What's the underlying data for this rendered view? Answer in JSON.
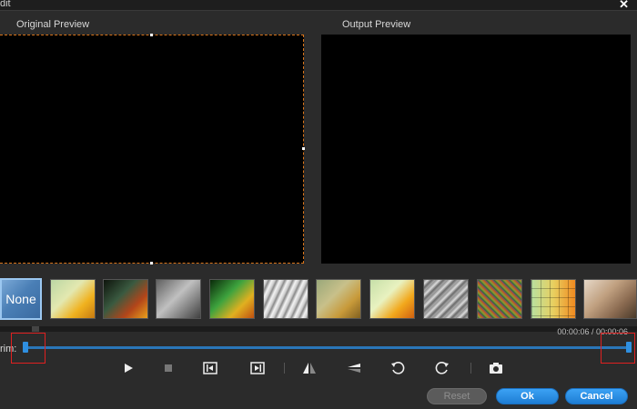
{
  "window": {
    "title": "dit",
    "close_icon": "close-icon"
  },
  "previews": {
    "original_label": "Original Preview",
    "output_label": "Output Preview"
  },
  "filters": {
    "none_label": "None",
    "thumbnails": [
      "none",
      "warm",
      "dark-red",
      "grayscale",
      "vivid",
      "sketch",
      "soft",
      "bright",
      "emboss",
      "noise",
      "mosaic",
      "sepia"
    ]
  },
  "timeline": {
    "time_readout": "00:00:06 / 00:00:06",
    "trim_label": "rim:",
    "trim_start_fraction": 0,
    "trim_end_fraction": 1
  },
  "controls": {
    "icons": [
      "play-icon",
      "stop-icon",
      "trim-start-marker-icon",
      "trim-end-marker-icon",
      "flip-horizontal-icon",
      "flip-vertical-icon",
      "rotate-left-icon",
      "rotate-right-icon",
      "snapshot-icon"
    ]
  },
  "buttons": {
    "reset": "Reset",
    "ok": "Ok",
    "cancel": "Cancel"
  },
  "colors": {
    "accent": "#2a76b8",
    "crop_border": "#d9741a",
    "highlight": "#e02020"
  }
}
